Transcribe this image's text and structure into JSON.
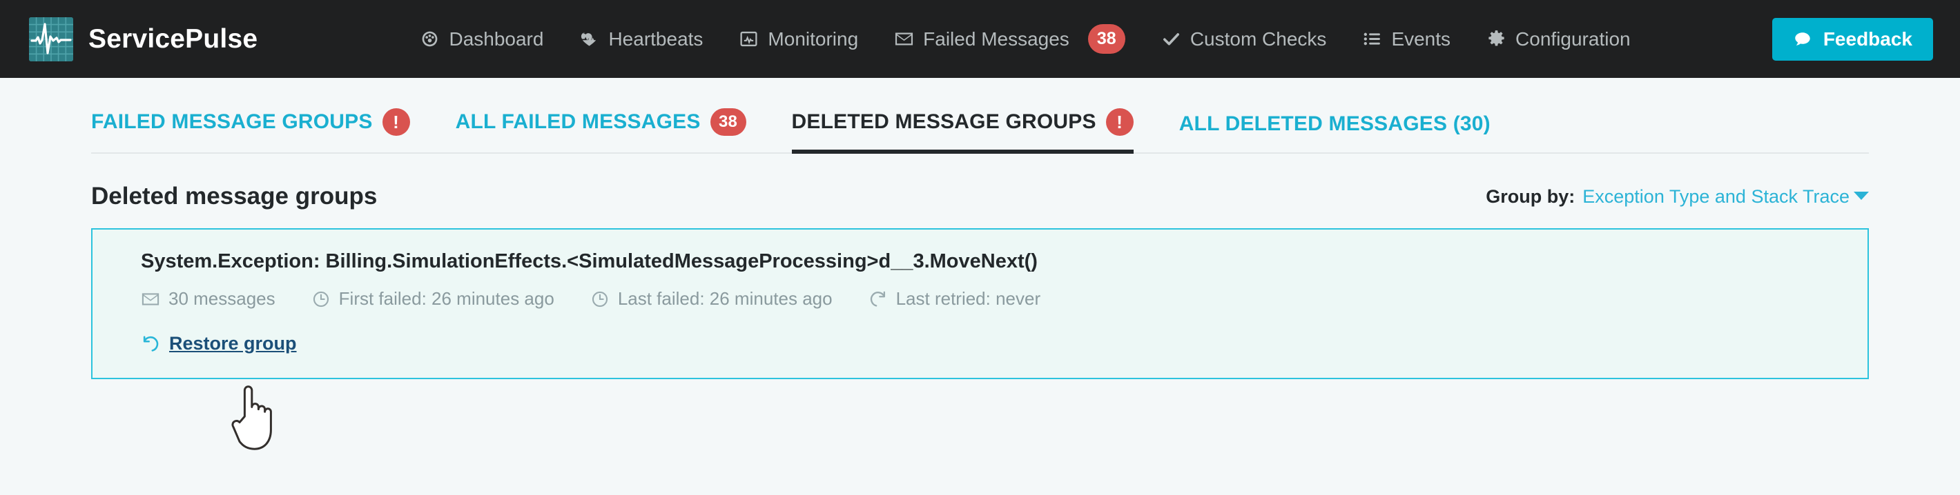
{
  "brand": {
    "name": "ServicePulse",
    "logo_icon": "pulse-waveform-icon"
  },
  "nav": {
    "items": [
      {
        "label": "Dashboard",
        "icon": "dashboard-gauge-icon",
        "badge": null
      },
      {
        "label": "Heartbeats",
        "icon": "heartbeat-icon",
        "badge": null
      },
      {
        "label": "Monitoring",
        "icon": "monitor-screen-icon",
        "badge": null
      },
      {
        "label": "Failed Messages",
        "icon": "envelope-icon",
        "badge": "38"
      },
      {
        "label": "Custom Checks",
        "icon": "check-icon",
        "badge": null
      },
      {
        "label": "Events",
        "icon": "list-icon",
        "badge": null
      },
      {
        "label": "Configuration",
        "icon": "gear-icon",
        "badge": null
      }
    ],
    "feedback": {
      "label": "Feedback",
      "icon": "speech-bubble-icon",
      "color": "#00b0cd"
    }
  },
  "tabs": [
    {
      "label": "FAILED MESSAGE GROUPS",
      "badge": "!",
      "badge_type": "alert",
      "active": false
    },
    {
      "label": "ALL FAILED MESSAGES",
      "badge": "38",
      "badge_type": "count",
      "active": false
    },
    {
      "label": "DELETED MESSAGE GROUPS",
      "badge": "!",
      "badge_type": "alert",
      "active": true
    },
    {
      "label": "ALL DELETED MESSAGES (30)",
      "badge": null,
      "badge_type": null,
      "active": false
    }
  ],
  "section": {
    "title": "Deleted message groups",
    "group_by_label": "Group by:",
    "group_by_value": "Exception Type and Stack Trace"
  },
  "group": {
    "title": "System.Exception: Billing.SimulationEffects.<SimulatedMessageProcessing>d__3.MoveNext()",
    "meta": [
      {
        "icon": "envelope-icon",
        "text": "30 messages"
      },
      {
        "icon": "clock-icon",
        "text": "First failed: 26 minutes ago"
      },
      {
        "icon": "clock-icon",
        "text": "Last failed: 26 minutes ago"
      },
      {
        "icon": "refresh-icon",
        "text": "Last retried: never"
      }
    ],
    "restore_label": "Restore group",
    "restore_icon": "undo-arrow-icon"
  },
  "colors": {
    "nav_bg": "#1f2021",
    "accent": "#00b0cd",
    "tab_link": "#1aafd0",
    "badge_red": "#d9534f",
    "card_border": "#2cc3de",
    "card_bg": "#edf8f6",
    "page_bg": "#f4f8f9",
    "restore_link": "#1b4f78"
  },
  "cursor": {
    "type": "pointing-hand"
  }
}
